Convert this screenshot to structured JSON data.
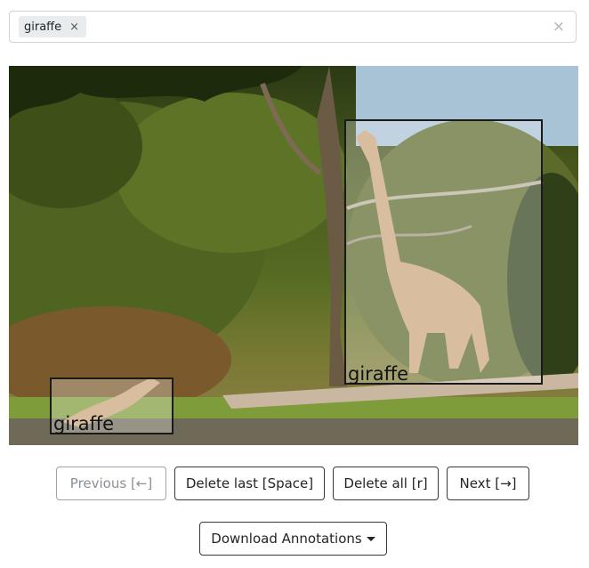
{
  "tag_input": {
    "tags": [
      {
        "label": "giraffe",
        "remove": "×"
      }
    ],
    "clear": "×"
  },
  "annotations": [
    {
      "label": "giraffe"
    },
    {
      "label": "giraffe"
    }
  ],
  "toolbar": {
    "previous": "Previous [←]",
    "delete_last": "Delete last [Space]",
    "delete_all": "Delete all [r]",
    "next": "Next [→]",
    "download": "Download Annotations"
  }
}
